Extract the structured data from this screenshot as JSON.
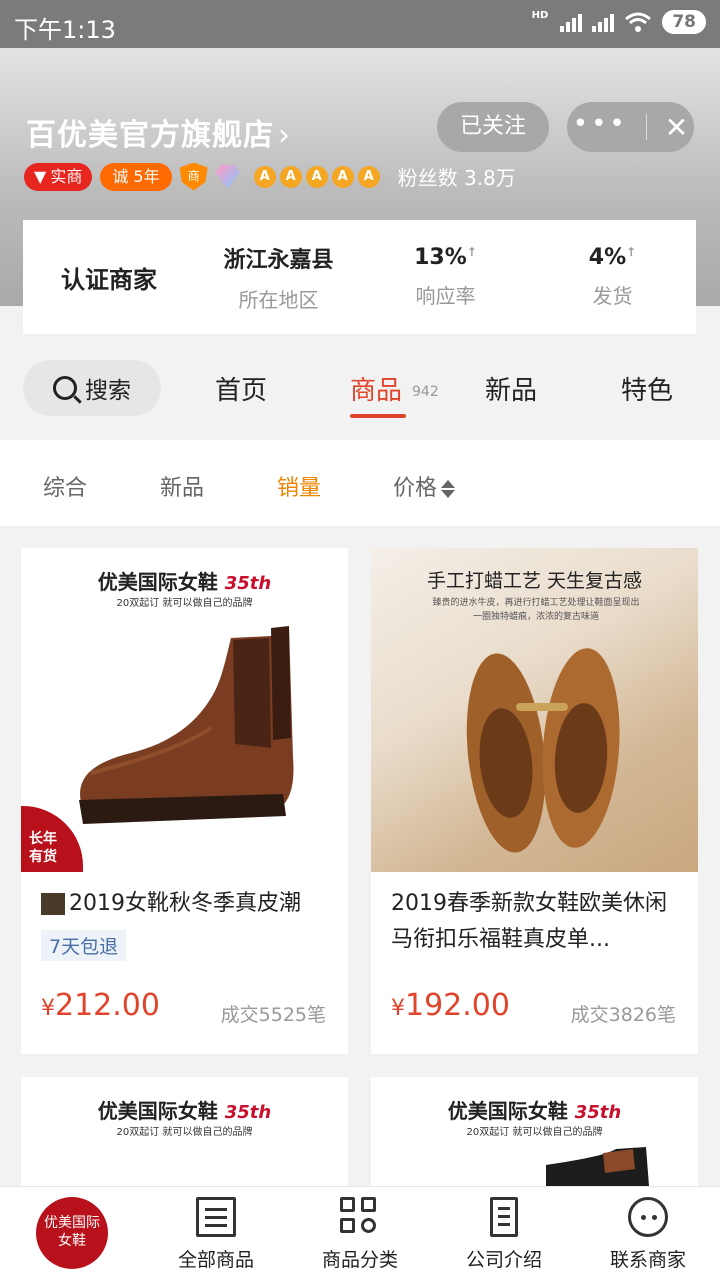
{
  "status_bar": {
    "time": "下午1:13",
    "network": "HD",
    "battery": "78"
  },
  "store": {
    "name": "百优美官方旗舰店",
    "chevron": "›",
    "follow_label": "已关注",
    "more_label": "•••",
    "close_label": "✕",
    "badges": {
      "shishang": "实商",
      "cheng": "诚 5年",
      "shield": "商"
    },
    "stars": [
      "A",
      "A",
      "A",
      "A",
      "A"
    ],
    "fans": "粉丝数 3.8万"
  },
  "info": {
    "cert": "认证商家",
    "location_value": "浙江永嘉县",
    "location_label": "所在地区",
    "response_value": "13%",
    "response_label": "响应率",
    "shipping_value": "4%",
    "shipping_label": "发货",
    "arrow": "↑"
  },
  "nav": {
    "search_label": "搜索",
    "tabs": [
      "首页",
      "商品",
      "新品",
      "特色"
    ],
    "product_count": "942",
    "active_tab": "商品"
  },
  "sort": {
    "options": [
      "综合",
      "新品",
      "销量",
      "价格"
    ],
    "active": "销量"
  },
  "products": [
    {
      "brand": "优美国际女鞋",
      "anniv": "35th",
      "brand_sub": "20双起订  就可以做自己的品牌",
      "stock_tag_1": "长年",
      "stock_tag_2": "有货",
      "title": "2019女靴秋冬季真皮潮",
      "returns": "7天包退",
      "price_symbol": "¥",
      "price": "212.00",
      "deals": "成交5525笔"
    },
    {
      "craft_head": "手工打蜡工艺  天生复古感",
      "craft_sub": "臻贵的进水牛皮，再进行打蜡工艺处理让鞋面呈现出一圈独特蜡痕，浓浓的复古味道",
      "title": "2019春季新款女鞋欧美休闲马衔扣乐福鞋真皮单...",
      "price_symbol": "¥",
      "price": "192.00",
      "deals": "成交3826笔"
    },
    {
      "brand": "优美国际女鞋",
      "anniv": "35th",
      "brand_sub": "20双起订  就可以做自己的品牌"
    },
    {
      "brand": "优美国际女鞋",
      "anniv": "35th",
      "brand_sub": "20双起订  就可以做自己的品牌"
    }
  ],
  "bottom_nav": {
    "logo_line1": "优美国际",
    "logo_line2": "女鞋",
    "items": [
      "全部商品",
      "商品分类",
      "公司介绍",
      "联系商家"
    ]
  },
  "colors": {
    "accent": "#e0452c",
    "sort_active": "#f08400",
    "brand_red": "#b8111b"
  }
}
